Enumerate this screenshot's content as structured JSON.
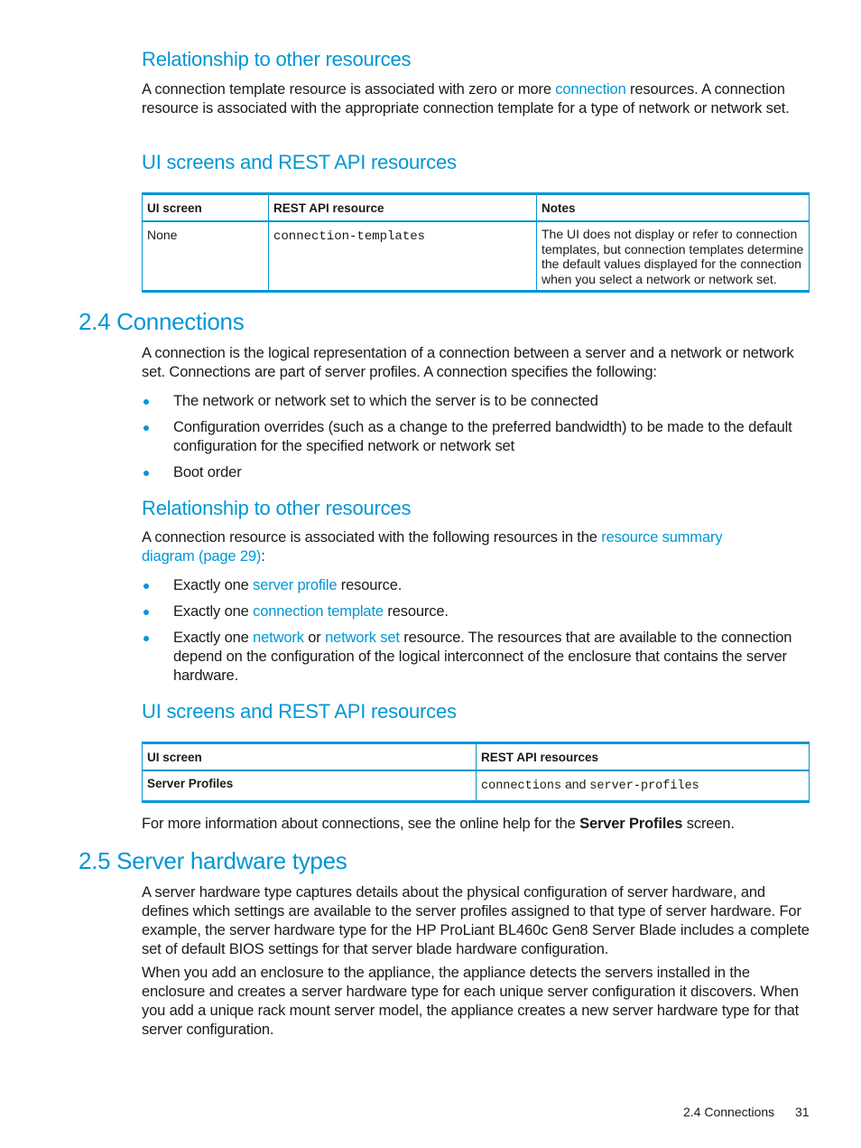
{
  "section_23_tail": {
    "relationship_heading": "Relationship to other resources",
    "relationship_text_pre": "A connection template resource is associated with zero or more ",
    "relationship_link": "connection",
    "relationship_text_post": " resources. A connection resource is associated with the appropriate connection template for a type of network or network set.",
    "ui_heading": "UI screens and REST API resources",
    "table": {
      "headers": [
        "UI screen",
        "REST API resource",
        "Notes"
      ],
      "rows": [
        {
          "ui_screen": "None",
          "rest_resource": "connection-templates",
          "notes": "The UI does not display or refer to connection templates, but connection templates determine the default values displayed for the connection when you select a network or network set."
        }
      ]
    }
  },
  "section_24": {
    "title": "2.4 Connections",
    "intro": "A connection is the logical representation of a connection between a server and a network or network set. Connections are part of server profiles. A connection specifies the following:",
    "bullets": [
      "The network or network set to which the server is to be connected",
      "Configuration overrides (such as a change to the preferred bandwidth) to be made to the default configuration for the specified network or network set",
      "Boot order"
    ],
    "relationship_heading": "Relationship to other resources",
    "relationship_text_pre": "A connection resource is associated with the following resources in the ",
    "relationship_link": "resource summary diagram (page 29)",
    "relationship_text_post": ":",
    "relationship_bullets": [
      {
        "pre": "Exactly one ",
        "link": "server profile",
        "post": " resource."
      },
      {
        "pre": "Exactly one ",
        "link": "connection template",
        "post": " resource."
      },
      {
        "pre": "Exactly one ",
        "link": "network",
        "mid": " or ",
        "link2": "network set",
        "post": " resource. The resources that are available to the connection depend on the configuration of the logical interconnect of the enclosure that contains the server hardware."
      }
    ],
    "ui_heading": "UI screens and REST API resources",
    "table": {
      "headers": [
        "UI screen",
        "REST API resources"
      ],
      "rows": [
        {
          "ui_screen": "Server Profiles",
          "rest_a": "connections",
          "rest_and": " and ",
          "rest_b": "server-profiles"
        }
      ]
    },
    "more_info_pre": "For more information about connections, see the online help for the ",
    "more_info_bold": "Server Profiles",
    "more_info_post": " screen."
  },
  "section_25": {
    "title": "2.5 Server hardware types",
    "para1": "A server hardware type captures details about the physical configuration of server hardware, and defines which settings are available to the server profiles assigned to that type of server hardware. For example, the server hardware type for the HP ProLiant BL460c Gen8 Server Blade includes a complete set of default BIOS settings for that server blade hardware configuration.",
    "para2": "When you add an enclosure to the appliance, the appliance detects the servers installed in the enclosure and creates a server hardware type for each unique server configuration it discovers. When you add a unique rack mount server model, the appliance creates a new server hardware type for that server configuration."
  },
  "footer": {
    "section": "2.4 Connections",
    "page_number": "31"
  },
  "colors": {
    "accent": "#0096d6",
    "text": "#1a1a1a"
  }
}
